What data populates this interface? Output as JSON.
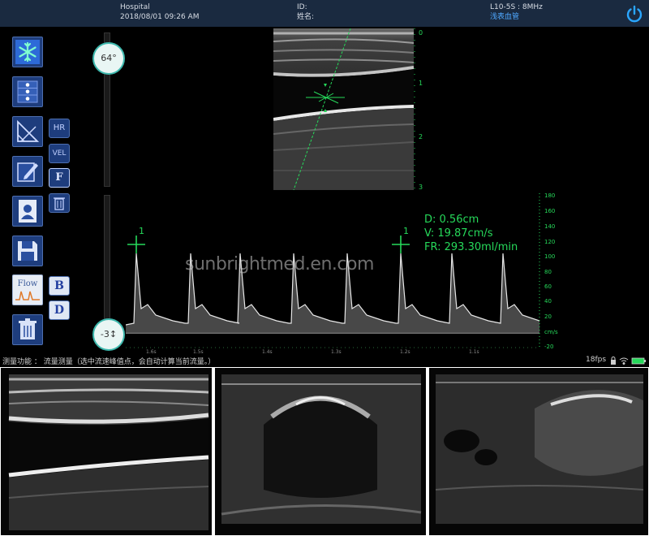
{
  "header": {
    "institution": "Hospital",
    "datetime": "2018/08/01 09:26 AM",
    "id_label": "ID:",
    "name_label": "姓名:",
    "probe": "L10-5S : 8MHz",
    "preset": "浅表血管",
    "power_icon": "power-icon"
  },
  "toolbar": {
    "buttons": [
      {
        "icon": "snowflake-freeze-icon"
      },
      {
        "icon": "dots-column-icon"
      },
      {
        "icon": "angle-measure-icon"
      },
      {
        "icon": "edit-pencil-icon"
      },
      {
        "icon": "patient-report-icon"
      },
      {
        "icon": "save-disk-icon"
      },
      {
        "icon": "flow-waveform-icon",
        "label": "Flow"
      },
      {
        "icon": "trash-icon"
      }
    ],
    "side_buttons": {
      "hr": "HR",
      "vel": "VEL",
      "f": "F",
      "b": "B",
      "d": "D",
      "trash_icon": "trash-icon"
    }
  },
  "controls": {
    "angle": "64°",
    "baseline": "-3"
  },
  "bmode": {
    "depth_ticks": [
      "0",
      "1",
      "2",
      "3"
    ]
  },
  "doppler": {
    "velocity_ticks": [
      "180",
      "160",
      "140",
      "120",
      "100",
      "80",
      "60",
      "40",
      "20",
      "cm/s",
      "-20"
    ],
    "time_ticks": [
      "1.6s",
      "1.5s",
      "1.4s",
      "1.3s",
      "1.2s",
      "1.1s"
    ],
    "caliper_labels": [
      "1",
      "1"
    ],
    "measurements": {
      "diameter": "D: 0.56cm",
      "velocity": "V: 19.87cm/s",
      "flow_rate": "FR: 293.30ml/min"
    },
    "watermark": "sunbrightmed.en.com"
  },
  "status": {
    "message": "测量功能 ： 流量测量（选中流速峰值点，会自动计算当前流量。）",
    "fps": "18fps",
    "icons": [
      "lock-icon",
      "wifi-icon",
      "battery-icon"
    ]
  },
  "colors": {
    "accent_green": "#26d95a",
    "topbar": "#1a2a40",
    "button_blue": "#1e3d7d",
    "knob_border": "#3db8ad"
  }
}
